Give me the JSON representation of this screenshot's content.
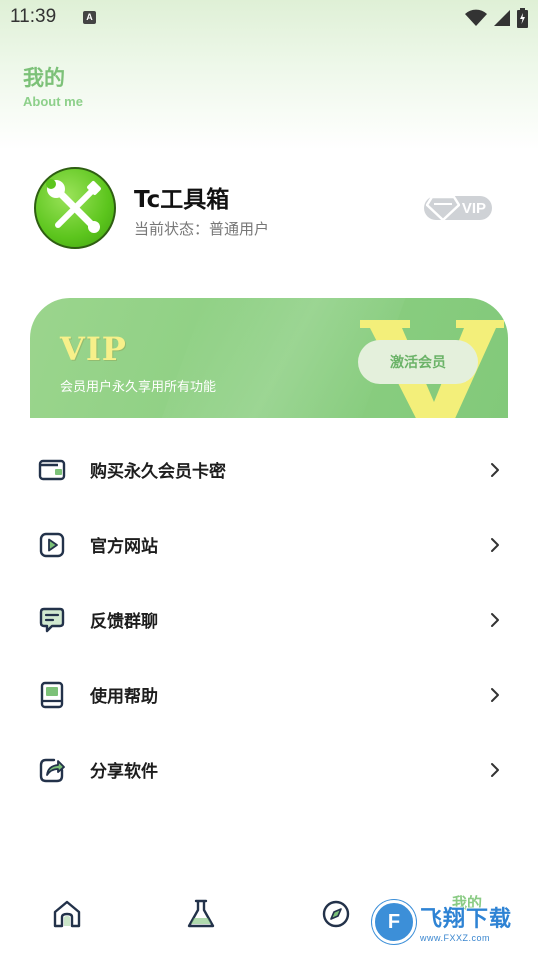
{
  "status_bar": {
    "time": "11:39",
    "notification_icon": "a-icon",
    "right_icons": [
      "wifi-icon",
      "signal-icon",
      "battery-charging-icon"
    ]
  },
  "header": {
    "title": "我的",
    "subtitle": "About me"
  },
  "profile": {
    "avatar_icon": "tools-wrench-screwdriver-icon",
    "app_name": "Tc工具箱",
    "status": "当前状态：普通用户",
    "vip_badge": "VIP"
  },
  "vip_card": {
    "title": "VIP",
    "description": "会员用户永久享用所有功能",
    "button_label": "激活会员",
    "big_letter": "V"
  },
  "menu": {
    "items": [
      {
        "label": "购买永久会员卡密",
        "icon": "wallet-icon"
      },
      {
        "label": "官方网站",
        "icon": "play-icon"
      },
      {
        "label": "反馈群聊",
        "icon": "chat-icon"
      },
      {
        "label": "使用帮助",
        "icon": "book-icon"
      },
      {
        "label": "分享软件",
        "icon": "share-icon"
      }
    ]
  },
  "bottom_nav": {
    "tabs": [
      {
        "icon": "home-icon"
      },
      {
        "icon": "flask-icon"
      },
      {
        "icon": "compass-icon"
      },
      {
        "label": "我的"
      }
    ]
  },
  "watermark": {
    "logo_letter": "F",
    "text": "飞翔下载",
    "url": "www.FXXZ.com"
  },
  "colors": {
    "accent": "#7cc178",
    "vip_card": "#8ccf82",
    "vip_gold": "#f7f08a"
  }
}
